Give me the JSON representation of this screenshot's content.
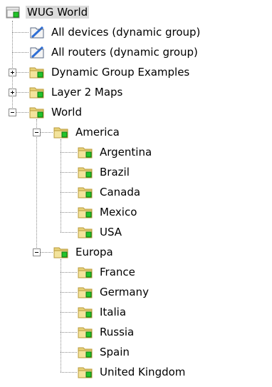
{
  "tree": {
    "root": {
      "label": "WUG World",
      "icon": "folder-root-icon"
    },
    "items": [
      {
        "label": "All devices (dynamic group)",
        "icon": "dynamic-group-icon",
        "depth": 1
      },
      {
        "label": "All routers (dynamic group)",
        "icon": "dynamic-group-icon",
        "depth": 1
      },
      {
        "label": "Dynamic Group Examples",
        "icon": "folder-icon",
        "depth": 1,
        "toggle": "collapsed"
      },
      {
        "label": "Layer 2 Maps",
        "icon": "folder-icon",
        "depth": 1,
        "toggle": "collapsed"
      },
      {
        "label": "World",
        "icon": "folder-green-icon",
        "depth": 1,
        "toggle": "expanded"
      },
      {
        "label": "America",
        "icon": "folder-green-icon",
        "depth": 2,
        "toggle": "expanded"
      },
      {
        "label": "Argentina",
        "icon": "folder-icon",
        "depth": 3
      },
      {
        "label": "Brazil",
        "icon": "folder-icon",
        "depth": 3
      },
      {
        "label": "Canada",
        "icon": "folder-icon",
        "depth": 3
      },
      {
        "label": "Mexico",
        "icon": "folder-icon",
        "depth": 3
      },
      {
        "label": "USA",
        "icon": "folder-icon",
        "depth": 3
      },
      {
        "label": "Europa",
        "icon": "folder-green-icon",
        "depth": 2,
        "toggle": "expanded"
      },
      {
        "label": "France",
        "icon": "folder-icon",
        "depth": 3
      },
      {
        "label": "Germany",
        "icon": "folder-icon",
        "depth": 3
      },
      {
        "label": "Italia",
        "icon": "folder-icon",
        "depth": 3
      },
      {
        "label": "Russia",
        "icon": "folder-icon",
        "depth": 3
      },
      {
        "label": "Spain",
        "icon": "folder-icon",
        "depth": 3
      },
      {
        "label": "United Kingdom",
        "icon": "folder-icon",
        "depth": 3
      }
    ]
  },
  "colors": {
    "folder": "#e8d27a",
    "folder_dark": "#b89a3a",
    "status_green": "#22c32a",
    "status_dark_green": "#0a7a10",
    "dynamic_blue": "#2f6fd6",
    "selection": "#dcdcdc",
    "tree_lines": "#8a8a8a"
  }
}
